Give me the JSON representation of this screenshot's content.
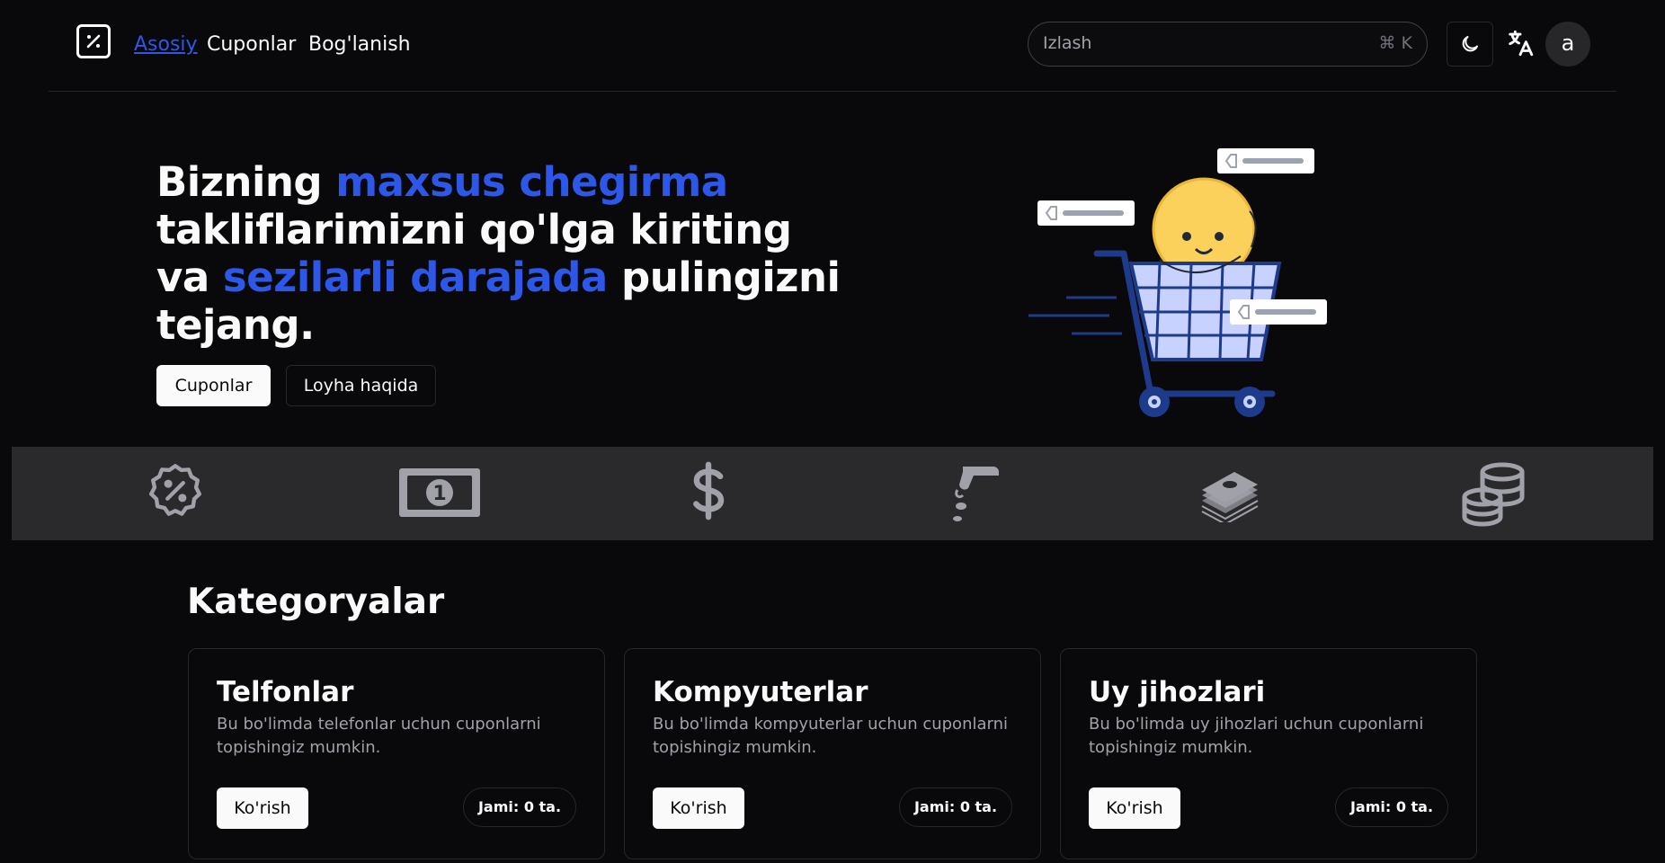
{
  "nav": {
    "links": [
      {
        "label": "Asosiy"
      },
      {
        "label": "Cuponlar"
      },
      {
        "label": "Bog'lanish"
      }
    ],
    "search": {
      "placeholder": "Izlash",
      "shortcut": "⌘ K"
    },
    "avatar_letter": "a"
  },
  "hero": {
    "title_parts": [
      "Bizning ",
      "maxsus chegirma",
      " takliflarimizni qo'lga kiriting va ",
      "sezilarli darajada",
      " pulingizni tejang."
    ],
    "primary_button": "Cuponlar",
    "secondary_button": "Loyha haqida"
  },
  "icon_strip": [
    "discount-badge-icon",
    "banknote-icon",
    "dollar-sign-icon",
    "hand-coin-icon",
    "money-stack-icon",
    "coins-stack-icon"
  ],
  "categories": {
    "heading": "Kategoryalar",
    "items": [
      {
        "title": "Telfonlar",
        "description": "Bu bo'limda telefonlar uchun cuponlarni topishingiz mumkin.",
        "button": "Ko'rish",
        "count": "Jami: 0 ta."
      },
      {
        "title": "Kompyuterlar",
        "description": "Bu bo'limda kompyuterlar uchun cuponlarni topishingiz mumkin.",
        "button": "Ko'rish",
        "count": "Jami: 0 ta."
      },
      {
        "title": "Uy jihozlari",
        "description": "Bu bo'limda uy jihozlari uchun cuponlarni topishingiz mumkin.",
        "button": "Ko'rish",
        "count": "Jami: 0 ta."
      }
    ]
  },
  "colors": {
    "background": "#09090b",
    "accent": "#2d57e8",
    "strip": "#2a2a2d",
    "border": "#27272a"
  }
}
